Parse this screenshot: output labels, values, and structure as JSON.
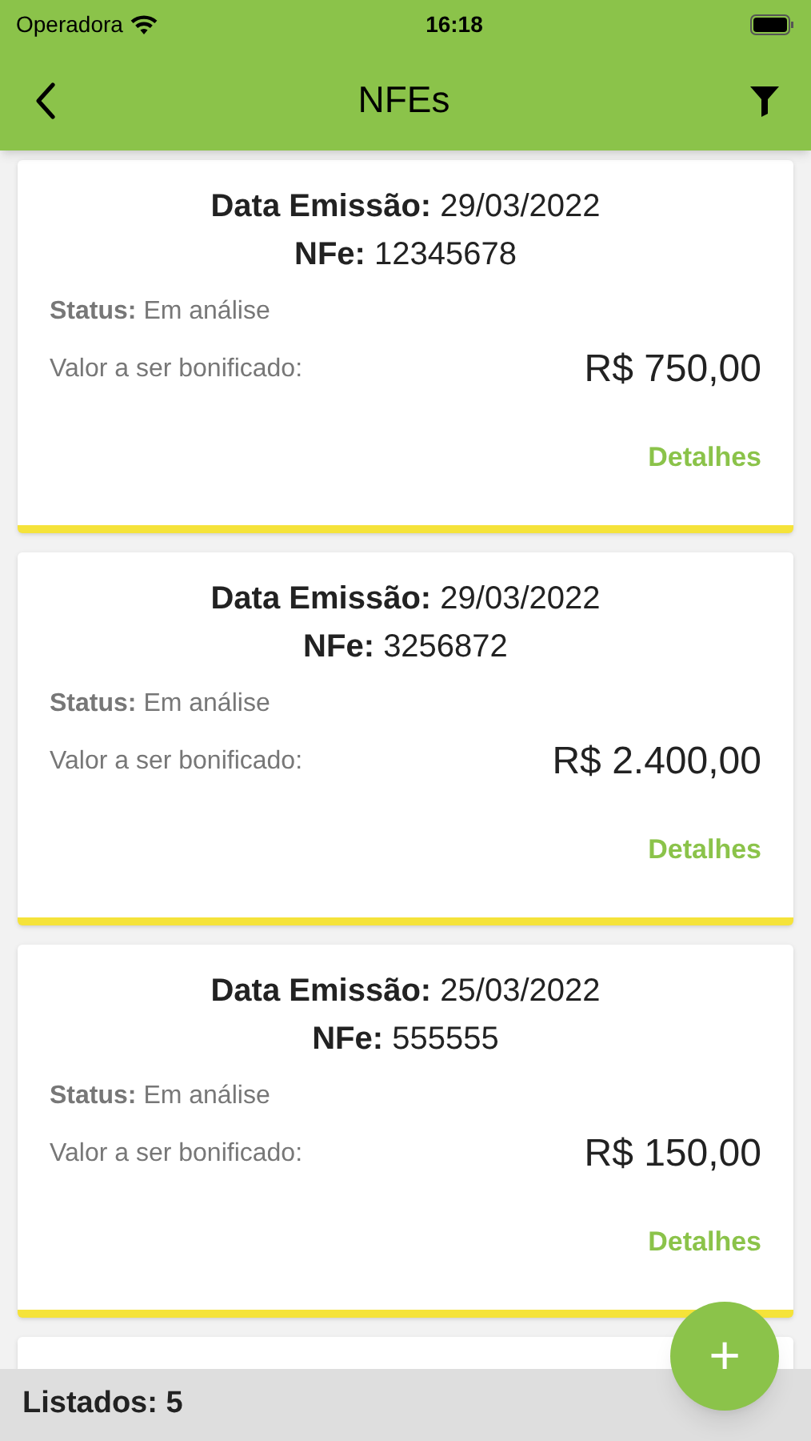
{
  "status_bar": {
    "carrier": "Operadora",
    "time": "16:18"
  },
  "header": {
    "title": "NFEs"
  },
  "cards": [
    {
      "date_label": "Data Emissão:",
      "date": "29/03/2022",
      "nfe_label": "NFe:",
      "nfe": "12345678",
      "status_label": "Status:",
      "status": "Em análise",
      "value_label": "Valor a ser bonificado:",
      "value": "R$ 750,00",
      "link": "Detalhes"
    },
    {
      "date_label": "Data Emissão:",
      "date": "29/03/2022",
      "nfe_label": "NFe:",
      "nfe": "3256872",
      "status_label": "Status:",
      "status": "Em análise",
      "value_label": "Valor a ser bonificado:",
      "value": "R$ 2.400,00",
      "link": "Detalhes"
    },
    {
      "date_label": "Data Emissão:",
      "date": "25/03/2022",
      "nfe_label": "NFe:",
      "nfe": "555555",
      "status_label": "Status:",
      "status": "Em análise",
      "value_label": "Valor a ser bonificado:",
      "value": "R$ 150,00",
      "link": "Detalhes"
    }
  ],
  "footer": {
    "count": "Listados: 5"
  },
  "fab": {
    "label": "+"
  }
}
